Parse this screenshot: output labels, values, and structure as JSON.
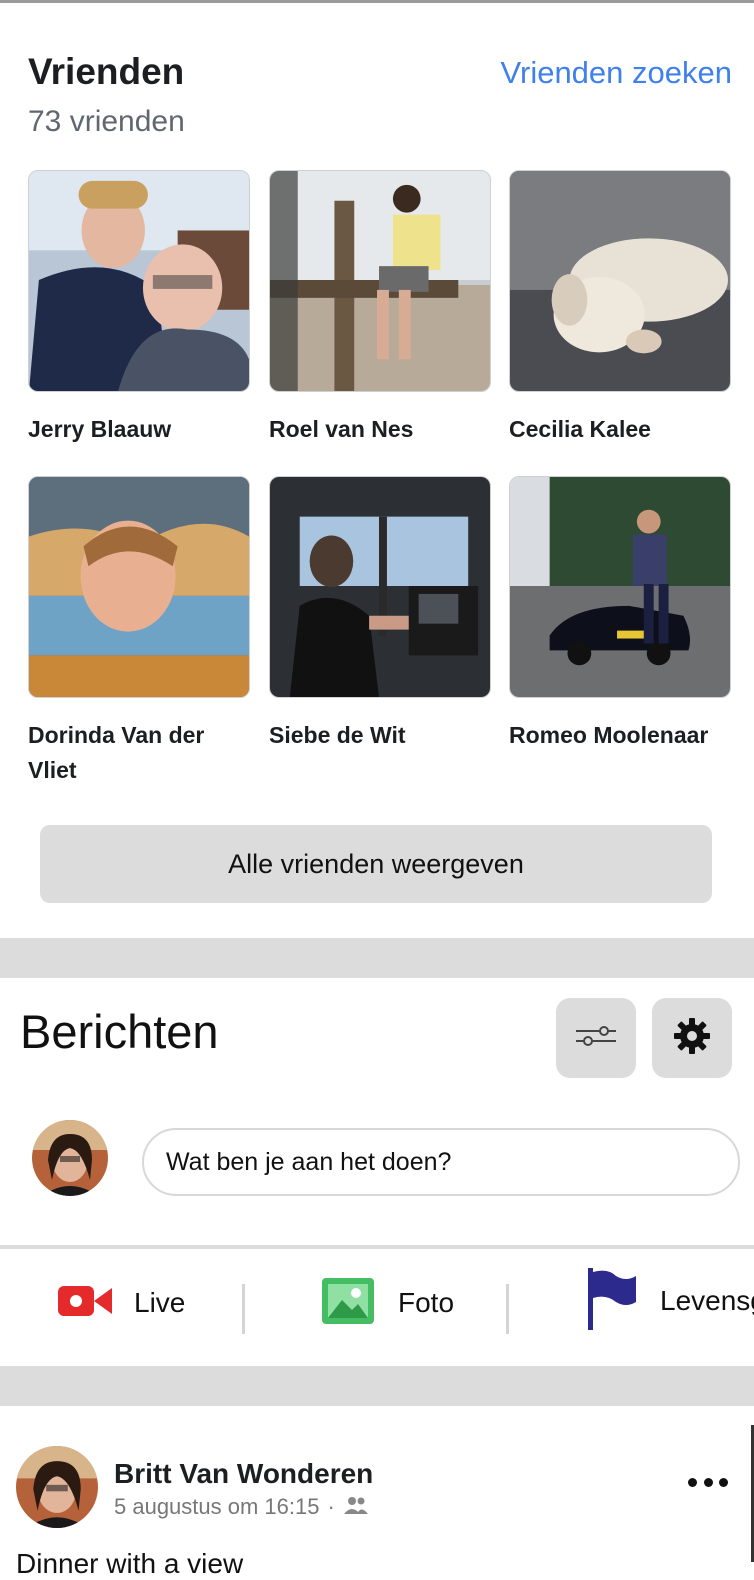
{
  "friends": {
    "title": "Vrienden",
    "count": "73 vrienden",
    "find_link": "Vrienden zoeken",
    "items": [
      {
        "name": "Jerry Blaauw"
      },
      {
        "name": "Roel van Nes"
      },
      {
        "name": "Cecilia Kalee"
      },
      {
        "name": "Dorinda Van der Vliet"
      },
      {
        "name": "Siebe de Wit"
      },
      {
        "name": "Romeo Moolenaar"
      }
    ],
    "all_button": "Alle vrienden weergeven"
  },
  "posts": {
    "title": "Berichten",
    "filter_icon": "sliders-icon",
    "settings_icon": "gear-icon",
    "composer_placeholder": "Wat ben je aan het doen?",
    "actions": [
      {
        "label": "Live",
        "icon": "video-camera-icon",
        "color": "#e42a2a"
      },
      {
        "label": "Foto",
        "icon": "photo-icon",
        "color": "#45bd62"
      },
      {
        "label": "Levensg",
        "icon": "flag-icon",
        "color": "#2d2a8e"
      }
    ]
  },
  "post": {
    "author": "Britt Van Wonderen",
    "date": "5 augustus om 16:15",
    "separator": "·",
    "audience_icon": "friends-icon",
    "text": "Dinner with a view"
  },
  "colors": {
    "link": "#4080ec",
    "divider": "#dcdcdc",
    "button_bg": "#dcdcdc"
  }
}
